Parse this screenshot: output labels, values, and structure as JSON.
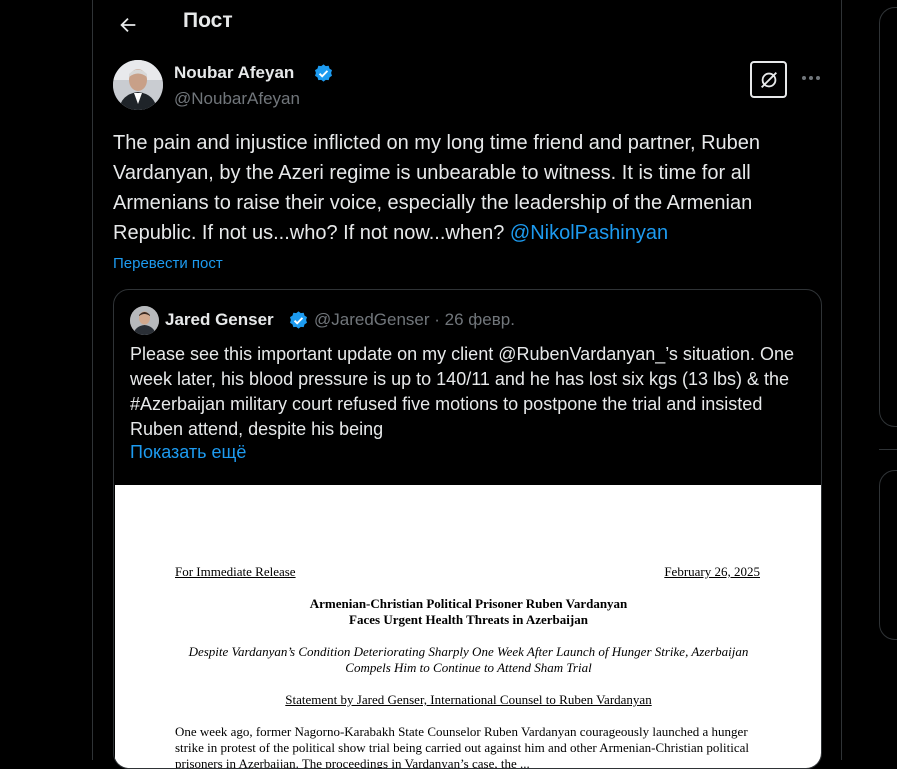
{
  "header": {
    "title": "Пост",
    "back_icon": "arrow-left-icon"
  },
  "post": {
    "author_name": "Noubar Afeyan",
    "author_handle": "@NoubarAfeyan",
    "verified_icon": "verified-badge-icon",
    "grok_icon": "grok-icon",
    "more_icon": "more-dots-icon",
    "text": "The pain and injustice inflicted on my long time friend and partner, Ruben Vardanyan, by the Azeri regime is unbearable to witness. It is time for all Armenians to raise their voice, especially the leadership of the Armenian Republic. If not us...who? If not now...when?",
    "mention": "@NikolPashinyan",
    "translate_label": "Перевести пост"
  },
  "quote": {
    "author_name": "Jared Genser",
    "author_handle": "@JaredGenser",
    "separator": "·",
    "date": "26 февр.",
    "text": "Please see this important update on my client @RubenVardanyan_’s situation. One week later, his blood pressure is up to 140/11 and he has lost six kgs (13 lbs) & the #Azerbaijan military court refused five motions to postpone the trial and insisted Ruben attend, despite his being",
    "show_more": "Показать ещё",
    "document": {
      "release": "For Immediate Release",
      "date": "February 26, 2025",
      "headline": "Armenian-Christian Political Prisoner Ruben Vardanyan Faces Urgent Health Threats in Azerbaijan",
      "subhead": "Despite Vardanyan’s Condition Deteriorating Sharply One Week After Launch of Hunger Strike, Azerbaijan Compels Him to Continue to Attend Sham Trial",
      "statement": "Statement by Jared Genser, International Counsel to Ruben Vardanyan",
      "body": "One week ago, former Nagorno-Karabakh State Counselor Ruben Vardanyan courageously launched a hunger strike in protest of the political show trial being carried out against him and other Armenian-Christian political prisoners in Azerbaijan. The proceedings in Vardanyan’s case, the ..."
    }
  },
  "colors": {
    "background": "#000000",
    "text": "#e7e9ea",
    "muted": "#71767b",
    "accent": "#1d9bf0",
    "border": "#2f3336"
  }
}
